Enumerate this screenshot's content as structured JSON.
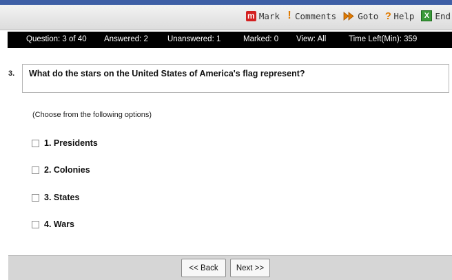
{
  "toolbar": {
    "mark": {
      "label": "Mark",
      "icon": "m-icon",
      "icon_glyph": "m"
    },
    "comments": {
      "label": "Comments",
      "icon": "exclamation-icon",
      "icon_glyph": "!"
    },
    "goto": {
      "label": "Goto",
      "icon": "double-arrow-icon"
    },
    "help": {
      "label": "Help",
      "icon": "question-icon",
      "icon_glyph": "?"
    },
    "end": {
      "label": "End",
      "icon": "x-icon",
      "icon_glyph": "X"
    }
  },
  "status": {
    "question": "Question: 3 of 40",
    "answered": "Answered: 2",
    "unanswered": "Unanswered: 1",
    "marked": "Marked: 0",
    "view": "View: All",
    "time_left": "Time Left(Min): 359"
  },
  "question": {
    "number": "3.",
    "text": "What do the stars on the United States of America's flag represent?"
  },
  "instructions": "(Choose from the following options)",
  "options": [
    {
      "label": "1. Presidents",
      "checked": false
    },
    {
      "label": "2. Colonies",
      "checked": false
    },
    {
      "label": "3. States",
      "checked": false
    },
    {
      "label": "4. Wars",
      "checked": false
    }
  ],
  "navigation": {
    "back_label": "<< Back",
    "next_label": "Next >>"
  },
  "colors": {
    "top_stripe": "#3e5fa6",
    "status_bar": "#000000",
    "mark_icon": "#d32020",
    "accent_orange": "#e07a00",
    "end_icon": "#3a9a3a"
  }
}
